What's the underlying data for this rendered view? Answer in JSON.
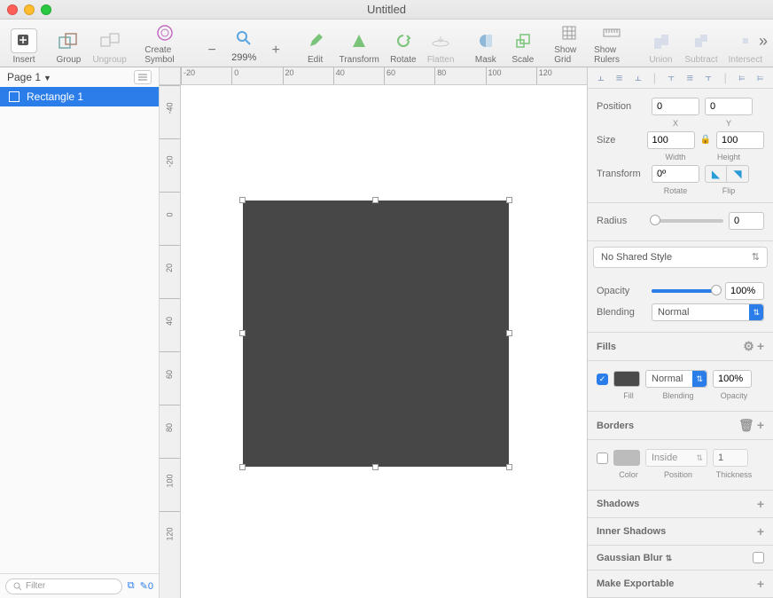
{
  "window": {
    "title": "Untitled"
  },
  "toolbar": {
    "insert": "Insert",
    "group": "Group",
    "ungroup": "Ungroup",
    "createSymbol": "Create Symbol",
    "zoom": "299%",
    "edit": "Edit",
    "transform": "Transform",
    "rotate": "Rotate",
    "flatten": "Flatten",
    "mask": "Mask",
    "scale": "Scale",
    "showGrid": "Show Grid",
    "showRulers": "Show Rulers",
    "union": "Union",
    "subtract": "Subtract",
    "intersect": "Intersect"
  },
  "sidebar": {
    "page": "Page 1",
    "layer1": "Rectangle 1",
    "filterPlaceholder": "Filter",
    "sliceCount": "0"
  },
  "rulerH": [
    "-20",
    "0",
    "20",
    "40",
    "60",
    "80",
    "100",
    "120"
  ],
  "rulerV": [
    "-40",
    "-20",
    "0",
    "20",
    "40",
    "60",
    "80",
    "100",
    "120"
  ],
  "inspector": {
    "positionLabel": "Position",
    "posX": "0",
    "posY": "0",
    "xLabel": "X",
    "yLabel": "Y",
    "sizeLabel": "Size",
    "width": "100",
    "height": "100",
    "wLabel": "Width",
    "hLabel": "Height",
    "transformLabel": "Transform",
    "rotate": "0º",
    "rotateLabel": "Rotate",
    "flipLabel": "Flip",
    "radiusLabel": "Radius",
    "radius": "0",
    "sharedStyle": "No Shared Style",
    "opacityLabel": "Opacity",
    "opacity": "100%",
    "blendingLabel": "Blending",
    "blendingMode": "Normal",
    "fillsHeader": "Fills",
    "fillLabel": "Fill",
    "fillBlending": "Normal",
    "fillBlendLabel": "Blending",
    "fillOpacity": "100%",
    "fillOpLabel": "Opacity",
    "bordersHeader": "Borders",
    "borderColorLabel": "Color",
    "borderPos": "Inside",
    "borderPosLabel": "Position",
    "borderThick": "1",
    "borderThickLabel": "Thickness",
    "shadowsHeader": "Shadows",
    "innerShadowsHeader": "Inner Shadows",
    "blurHeader": "Gaussian Blur",
    "exportHeader": "Make Exportable"
  }
}
